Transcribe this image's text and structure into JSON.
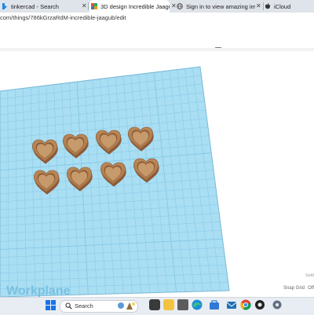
{
  "browser": {
    "tabs": [
      {
        "label": "tinkercad - Search",
        "active": false
      },
      {
        "label": "3D design Incredible Jaagub | Tin",
        "active": true
      },
      {
        "label": "Sign in to view amazing images",
        "active": false
      },
      {
        "label": "iCloud",
        "active": false
      }
    ],
    "address": "com/things/786kGrzaRdM-incredible-jaagub/edit"
  },
  "editor": {
    "view_tools": [
      "note-icon",
      "ruler-icon",
      "shape-icon",
      "group-icon",
      "align-icon",
      "mirror-icon"
    ],
    "workplane_watermark": "Workplane",
    "settings_label": "Setti",
    "snap_grid_label": "Snap Grid",
    "snap_grid_value": "Off",
    "hearts_count": 8
  },
  "taskbar": {
    "search_placeholder": "Search"
  },
  "colors": {
    "grid_fill": "#a9def3",
    "grid_line": "#86c8e6",
    "heart_body": "#8d5a36",
    "heart_top": "#b98957",
    "heart_inner": "#c69a6a"
  }
}
